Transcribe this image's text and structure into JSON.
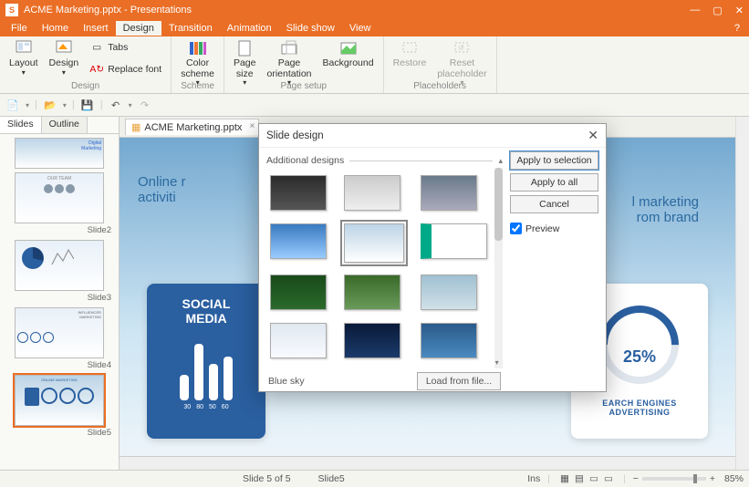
{
  "window": {
    "title": "ACME Marketing.pptx - Presentations",
    "app_letter": "S"
  },
  "menu": {
    "items": [
      "File",
      "Home",
      "Insert",
      "Design",
      "Transition",
      "Animation",
      "Slide show",
      "View"
    ],
    "active_index": 3,
    "help": "?"
  },
  "ribbon": {
    "design": {
      "layout": "Layout",
      "design": "Design",
      "tabs": "Tabs",
      "replace_font": "Replace font",
      "label": "Design"
    },
    "scheme": {
      "color_scheme": "Color\nscheme",
      "label": "Scheme"
    },
    "page_setup": {
      "page_size": "Page\nsize",
      "page_orientation": "Page\norientation",
      "background": "Background",
      "label": "Page setup"
    },
    "placeholders": {
      "restore": "Restore",
      "reset": "Reset\nplaceholder",
      "label": "Placeholders"
    }
  },
  "document_tab": {
    "name": "ACME Marketing.pptx"
  },
  "sidepanel": {
    "tabs": [
      "Slides",
      "Outline"
    ],
    "active": 0,
    "slides": [
      {
        "label": "Slide2"
      },
      {
        "label": "Slide3"
      },
      {
        "label": "Slide4"
      },
      {
        "label": "Slide5"
      }
    ]
  },
  "slide": {
    "body_text_1": "Online r",
    "body_text_2": "activiti",
    "body_text_3": "l marketing",
    "body_text_4": "rom brand",
    "social_media": {
      "title": "SOCIAL\nMEDIA",
      "bars": [
        30,
        80,
        50,
        60
      ],
      "labels": [
        "30",
        "80",
        "50",
        "60"
      ]
    },
    "search": {
      "pct": "25%",
      "caption": "EARCH ENGINES\nADVERTISING"
    }
  },
  "dialog": {
    "title": "Slide design",
    "section": "Additional designs",
    "footer_label": "Blue sky",
    "apply_sel": "Apply to selection",
    "apply_all": "Apply to all",
    "cancel": "Cancel",
    "preview": "Preview",
    "load": "Load from file..."
  },
  "statusbar": {
    "page": "Slide 5 of 5",
    "slide_name": "Slide5",
    "ins": "Ins",
    "plus": "+",
    "zoom": "85%"
  }
}
